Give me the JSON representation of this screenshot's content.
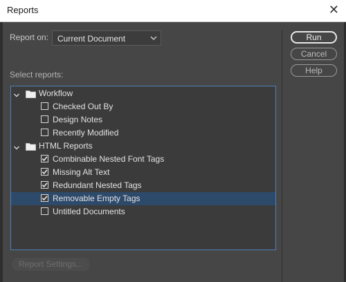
{
  "window": {
    "title": "Reports",
    "close_symbol": "✕"
  },
  "report_on": {
    "label": "Report on:",
    "selected": "Current Document"
  },
  "select_reports_label": "Select reports:",
  "tree": {
    "groups": [
      {
        "label": "Workflow",
        "items": [
          {
            "label": "Checked Out By",
            "checked": false
          },
          {
            "label": "Design Notes",
            "checked": false
          },
          {
            "label": "Recently Modified",
            "checked": false
          }
        ]
      },
      {
        "label": "HTML Reports",
        "items": [
          {
            "label": "Combinable Nested Font Tags",
            "checked": true
          },
          {
            "label": "Missing Alt Text",
            "checked": true
          },
          {
            "label": "Redundant Nested Tags",
            "checked": true
          },
          {
            "label": "Removable Empty Tags",
            "checked": true,
            "selected": true
          },
          {
            "label": "Untitled Documents",
            "checked": false
          }
        ]
      }
    ]
  },
  "buttons": {
    "run": "Run",
    "cancel": "Cancel",
    "help": "Help",
    "report_settings": "Report Settings..."
  },
  "icons": {
    "expander": "chevron-down-icon",
    "folder": "folder-icon",
    "checkbox": "checkbox-icon"
  },
  "colors": {
    "dialog_bg": "#464646",
    "tree_bg": "#3b3b3b",
    "tree_border": "#5080b8",
    "selected_row": "#2e4a6b"
  }
}
